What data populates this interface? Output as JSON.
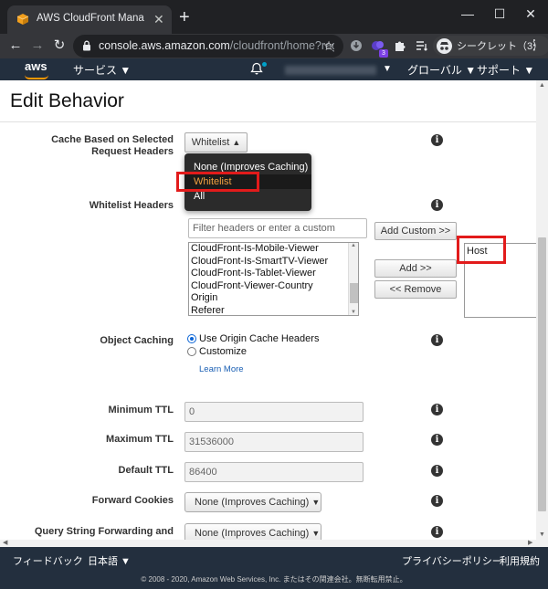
{
  "browser": {
    "tab_title": "AWS CloudFront Management Co",
    "tab_close": "✕",
    "new_tab": "+",
    "window_controls": {
      "minimize": "—",
      "maximize": "☐",
      "close": "✕"
    },
    "url_host": "console.aws.amazon.com",
    "url_path": "/cloudfront/home?regio...",
    "extension_badge": "3",
    "incognito_label": "シークレット（3）"
  },
  "aws_nav": {
    "logo": "aws",
    "services": "サービス ▼",
    "account_dropdown": "▼",
    "region": "グローバル ▼",
    "support": "サポート ▼"
  },
  "page": {
    "title": "Edit Behavior",
    "cache_headers": {
      "label": "Cache Based on Selected Request Headers",
      "selected": "Whitelist",
      "options": [
        "None (Improves Caching)",
        "Whitelist",
        "All"
      ],
      "selected_index": 1
    },
    "whitelist_headers": {
      "label": "Whitelist Headers",
      "filter_placeholder": "Filter headers or enter a custom header",
      "add_custom": "Add Custom >>",
      "add": "Add >>",
      "remove": "<< Remove",
      "available": [
        "CloudFront-Is-Mobile-Viewer",
        "CloudFront-Is-SmartTV-Viewer",
        "CloudFront-Is-Tablet-Viewer",
        "CloudFront-Viewer-Country",
        "Origin",
        "Referer"
      ],
      "selected_headers": [
        "Host"
      ]
    },
    "object_caching": {
      "label": "Object Caching",
      "options": [
        "Use Origin Cache Headers",
        "Customize"
      ],
      "selected": "Use Origin Cache Headers",
      "learn_more": "Learn More"
    },
    "minimum_ttl": {
      "label": "Minimum TTL",
      "value": "0"
    },
    "maximum_ttl": {
      "label": "Maximum TTL",
      "value": "31536000"
    },
    "default_ttl": {
      "label": "Default TTL",
      "value": "86400"
    },
    "forward_cookies": {
      "label": "Forward Cookies",
      "value": "None (Improves Caching)"
    },
    "query_string": {
      "label": "Query String Forwarding and",
      "value": "None (Improves Caching)"
    },
    "info": "i"
  },
  "footer": {
    "feedback": "フィードバック",
    "language": "日本語 ▼",
    "privacy": "プライバシーポリシー",
    "terms": "利用規約",
    "copyright": "© 2008 - 2020, Amazon Web Services, Inc. またはその関連会社。無断転用禁止。"
  },
  "colors": {
    "chrome_dark": "#202124",
    "chrome_toolbar": "#35363a",
    "aws_nav": "#232f3e",
    "aws_orange": "#ff9900",
    "annotation_red": "#e21b1b",
    "link_blue": "#1a5fb4"
  }
}
